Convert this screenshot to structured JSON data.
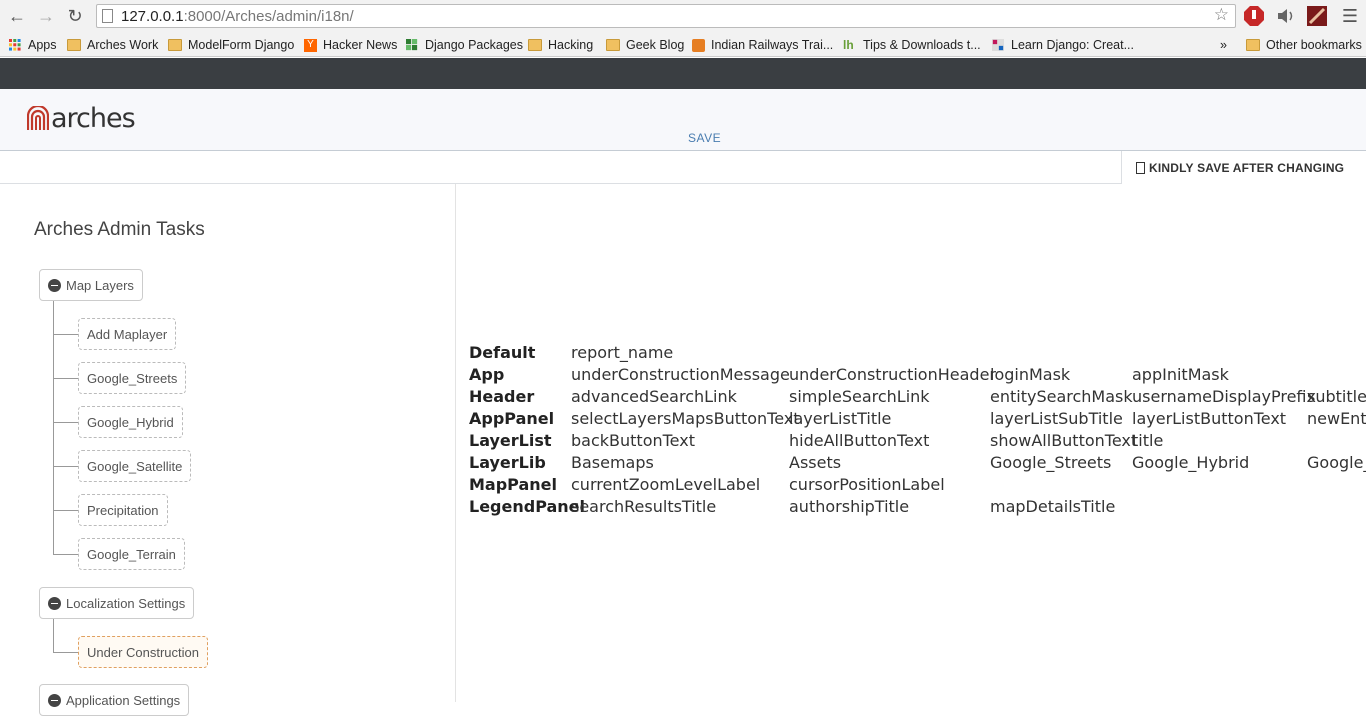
{
  "browser": {
    "url_host": "127.0.0.1",
    "url_path": ":8000/Arches/admin/i18n/",
    "bookmarks": [
      {
        "label": "Apps",
        "icon": "apps-grid-icon"
      },
      {
        "label": "Arches Work",
        "icon": "folder-icon"
      },
      {
        "label": "ModelForm Django",
        "icon": "folder-icon"
      },
      {
        "label": "Hacker News",
        "icon": "hackernews-icon"
      },
      {
        "label": "Django Packages",
        "icon": "djangopackages-icon"
      },
      {
        "label": "Hacking",
        "icon": "folder-icon"
      },
      {
        "label": "Geek Blog",
        "icon": "folder-icon"
      },
      {
        "label": "Indian Railways Trai...",
        "icon": "railways-icon"
      },
      {
        "label": "Tips & Downloads t...",
        "icon": "tips-icon"
      },
      {
        "label": "Learn Django: Creat...",
        "icon": "learndjango-icon"
      }
    ],
    "overflow": "»",
    "other_bookmarks": "Other bookmarks"
  },
  "header": {
    "logo_text": "arches",
    "save_label": "SAVE",
    "kindly_label": "KINDLY SAVE AFTER CHANGING"
  },
  "sidebar": {
    "title": "Arches Admin Tasks",
    "map_layers": "Map Layers",
    "map_layer_items": [
      "Add Maplayer",
      "Google_Streets",
      "Google_Hybrid",
      "Google_Satellite",
      "Precipitation",
      "Google_Terrain"
    ],
    "localization": "Localization Settings",
    "localization_items": [
      "Under Construction"
    ],
    "application": "Application Settings"
  },
  "table": {
    "rows": [
      {
        "head": "Default",
        "cells": [
          "report_name"
        ]
      },
      {
        "head": "App",
        "cells": [
          "underConstructionMessage",
          "underConstructionHeader",
          "loginMask",
          "appInitMask"
        ]
      },
      {
        "head": "Header",
        "cells": [
          "advancedSearchLink",
          "simpleSearchLink",
          "entitySearchMask",
          "usernameDisplayPrefix",
          "subtitle"
        ]
      },
      {
        "head": "AppPanel",
        "cells": [
          "selectLayersMapsButtonText",
          "layerListTitle",
          "layerListSubTitle",
          "layerListButtonText",
          "newEnti"
        ]
      },
      {
        "head": "LayerList",
        "cells": [
          "backButtonText",
          "hideAllButtonText",
          "showAllButtonText",
          "title"
        ]
      },
      {
        "head": "LayerLib",
        "cells": [
          "Basemaps",
          "Assets",
          "Google_Streets",
          "Google_Hybrid",
          "Google_"
        ]
      },
      {
        "head": "MapPanel",
        "cells": [
          "currentZoomLevelLabel",
          "cursorPositionLabel"
        ]
      },
      {
        "head": "LegendPanel",
        "cells": [
          "searchResultsTitle",
          "authorshipTitle",
          "mapDetailsTitle"
        ]
      }
    ]
  },
  "colors": {
    "accent": "#4a7db0",
    "logo_red": "#c0392b",
    "dark_bar": "#3a3e42"
  }
}
